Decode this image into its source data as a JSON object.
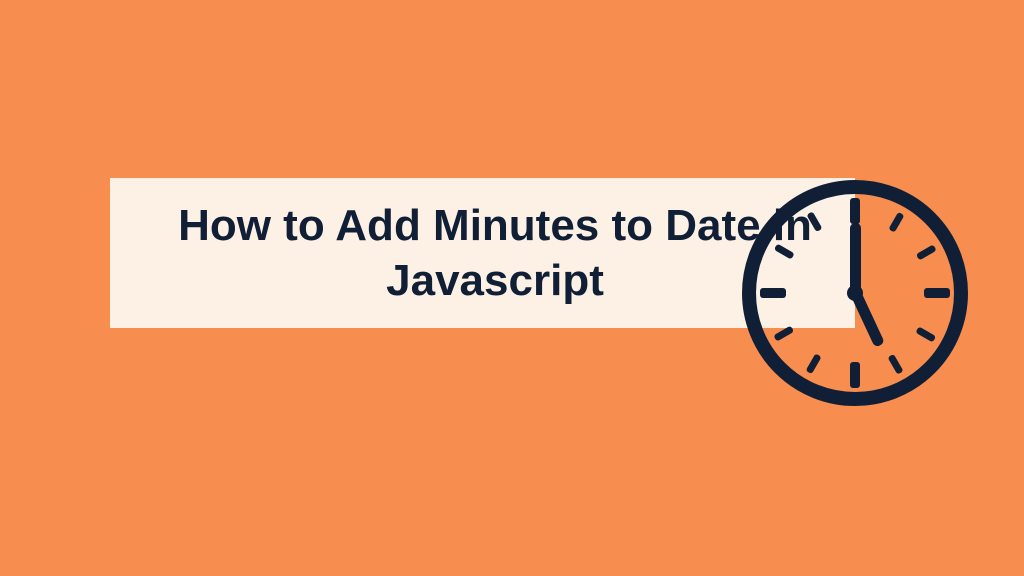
{
  "title": "How to Add Minutes to Date in Javascript",
  "colors": {
    "background": "#f78d4f",
    "box": "#fdf1e6",
    "text": "#101f35",
    "clock": "#101f35"
  }
}
